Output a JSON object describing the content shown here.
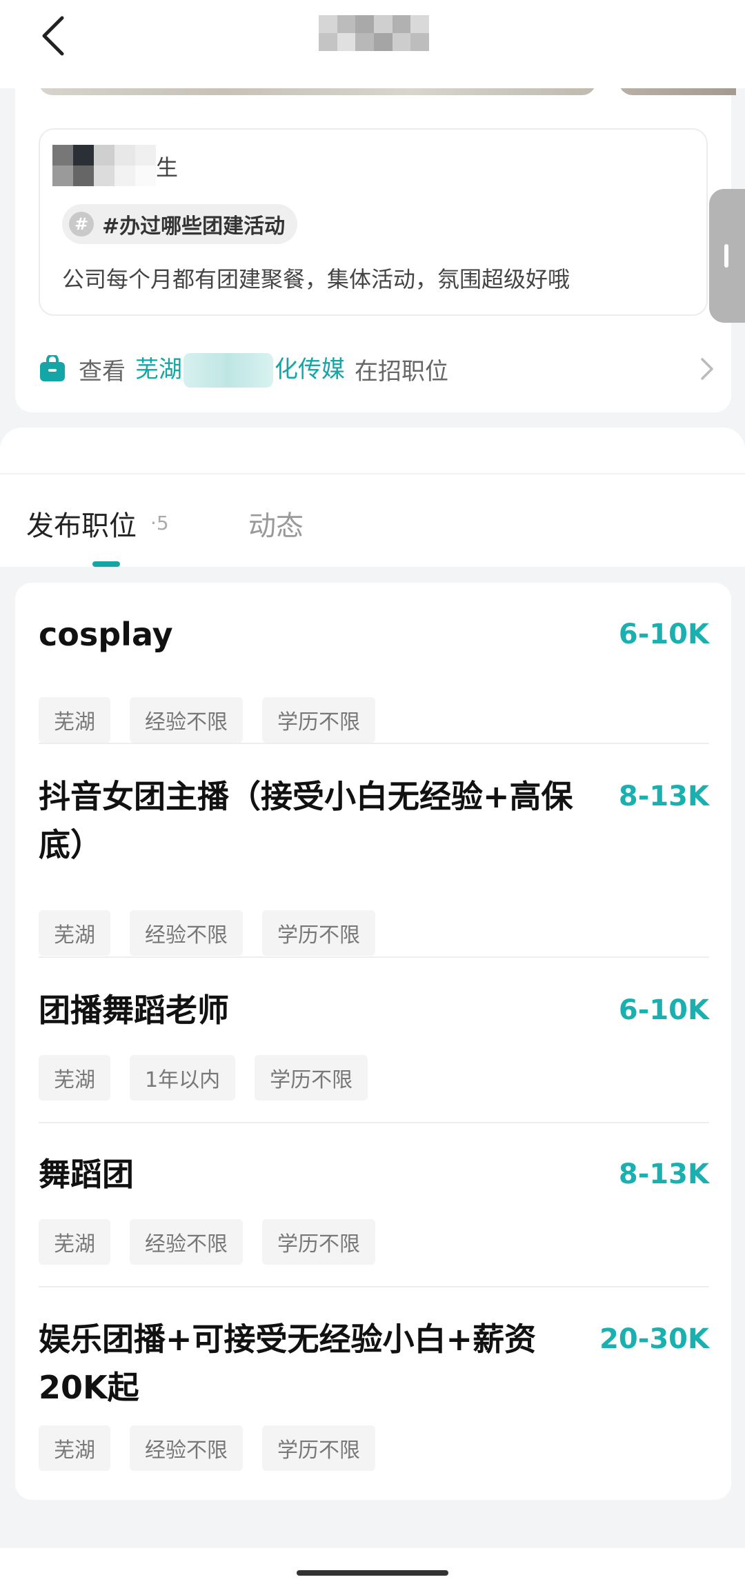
{
  "review": {
    "name_suffix": "生",
    "topic": "#办过哪些团建活动",
    "body": "公司每个月都有团建聚餐，集体活动，氛围超级好哦"
  },
  "jobs_link": {
    "prefix": "查看",
    "company_start": "芜湖",
    "company_end": "化传媒",
    "suffix": "在招职位"
  },
  "tabs": {
    "jobs_label": "发布职位",
    "jobs_count": "·5",
    "feed_label": "动态"
  },
  "jobs": [
    {
      "title": "cosplay",
      "salary": "6-10K",
      "tags": [
        "芜湖",
        "经验不限",
        "学历不限"
      ]
    },
    {
      "title": "抖音女团主播（接受小白无经验+高保底）",
      "salary": "8-13K",
      "tags": [
        "芜湖",
        "经验不限",
        "学历不限"
      ]
    },
    {
      "title": "团播舞蹈老师",
      "salary": "6-10K",
      "tags": [
        "芜湖",
        "1年以内",
        "学历不限"
      ]
    },
    {
      "title": "舞蹈团",
      "salary": "8-13K",
      "tags": [
        "芜湖",
        "经验不限",
        "学历不限"
      ]
    },
    {
      "title": "娱乐团播+可接受无经验小白+薪资20K起",
      "salary": "20-30K",
      "tags": [
        "芜湖",
        "经验不限",
        "学历不限"
      ]
    }
  ],
  "colors": {
    "accent": "#14a6a6",
    "salary": "#1ab0b0"
  }
}
